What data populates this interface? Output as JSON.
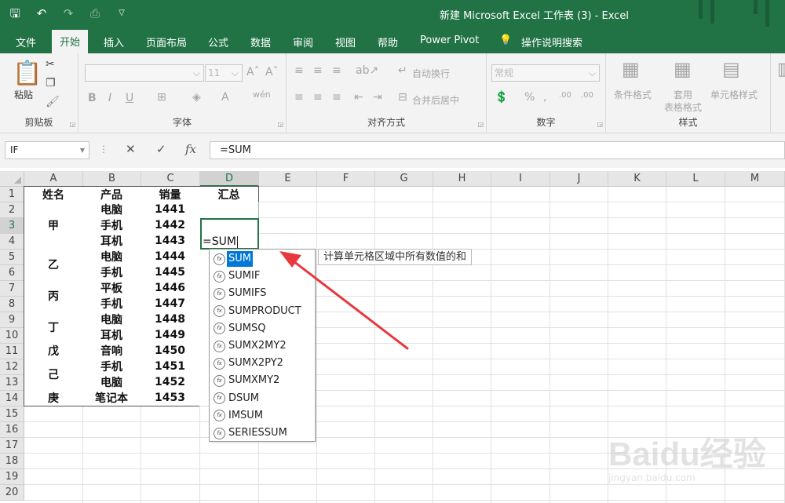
{
  "window": {
    "title": "新建 Microsoft Excel 工作表 (3)  -  Excel"
  },
  "ribbon_tabs": [
    {
      "label": "文件",
      "active": false
    },
    {
      "label": "开始",
      "active": true
    },
    {
      "label": "插入",
      "active": false
    },
    {
      "label": "页面布局",
      "active": false
    },
    {
      "label": "公式",
      "active": false
    },
    {
      "label": "数据",
      "active": false
    },
    {
      "label": "审阅",
      "active": false
    },
    {
      "label": "视图",
      "active": false
    },
    {
      "label": "帮助",
      "active": false
    },
    {
      "label": "Power Pivot",
      "active": false
    }
  ],
  "tell_me": "操作说明搜索",
  "ribbon": {
    "clipboard": {
      "label": "剪贴板",
      "paste": "粘贴"
    },
    "font": {
      "label": "字体",
      "size": "11"
    },
    "alignment": {
      "label": "对齐方式",
      "wrap_text": "自动换行",
      "merge_center": "合并后居中"
    },
    "number": {
      "label": "数字",
      "format": "常规"
    },
    "styles": {
      "label": "样式",
      "conditional": "条件格式",
      "table_format_1": "套用",
      "table_format_2": "表格格式",
      "cell_styles": "单元格样式"
    }
  },
  "formula_bar": {
    "name_box": "IF",
    "formula": "=SUM"
  },
  "columns": [
    "A",
    "B",
    "C",
    "D",
    "E",
    "F",
    "G",
    "H",
    "I",
    "J",
    "K",
    "L",
    "M"
  ],
  "rows": [
    "1",
    "2",
    "3",
    "4",
    "5",
    "6",
    "7",
    "8",
    "9",
    "10",
    "11",
    "12",
    "13",
    "14",
    "15",
    "16",
    "17",
    "18",
    "19",
    "20"
  ],
  "table": {
    "headers": [
      "姓名",
      "产品",
      "销量",
      "汇总"
    ],
    "name_groups": [
      "甲",
      "乙",
      "丙",
      "丁",
      "戊",
      "己",
      "庚"
    ],
    "products": [
      "电脑",
      "手机",
      "耳机",
      "电脑",
      "手机",
      "平板",
      "手机",
      "电脑",
      "耳机",
      "音响",
      "手机",
      "电脑",
      "笔记本"
    ],
    "sales": [
      "1441",
      "1442",
      "1443",
      "1444",
      "1445",
      "1446",
      "1447",
      "1448",
      "1449",
      "1450",
      "1451",
      "1452",
      "1453"
    ]
  },
  "active_cell": {
    "ref": "D3",
    "value": "=SUM"
  },
  "autocomplete": {
    "items": [
      "SUM",
      "SUMIF",
      "SUMIFS",
      "SUMPRODUCT",
      "SUMSQ",
      "SUMX2MY2",
      "SUMX2PY2",
      "SUMXMY2",
      "DSUM",
      "IMSUM",
      "SERIESSUM"
    ],
    "selected": "SUM",
    "tooltip": "计算单元格区域中所有数值的和"
  },
  "watermark": {
    "brand": "Baidu经验",
    "url": "jingyan.baidu.com"
  },
  "colors": {
    "excel_green": "#217346",
    "selection_blue": "#0078d7",
    "arrow_red": "#e8383d"
  }
}
